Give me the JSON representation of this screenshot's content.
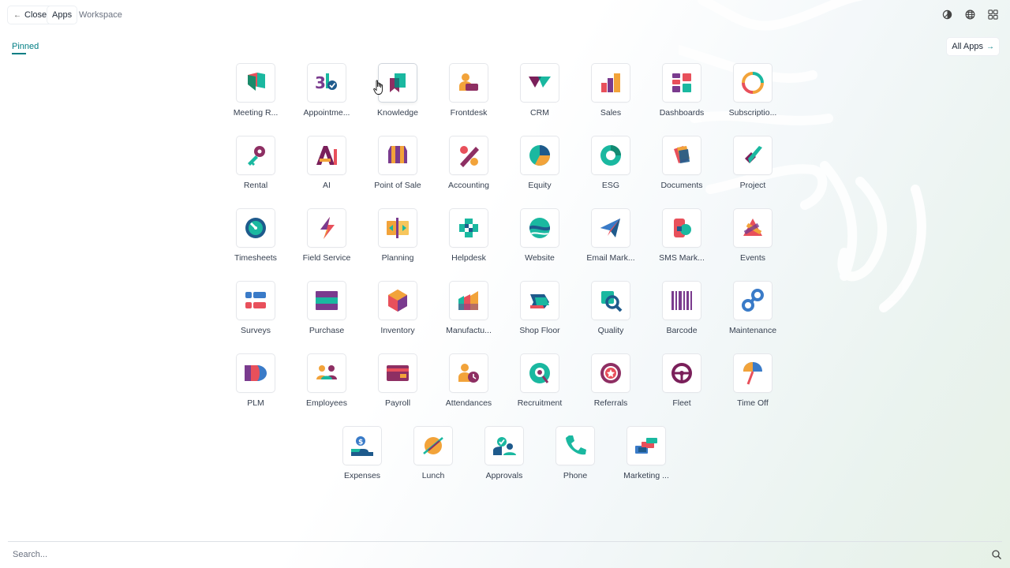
{
  "topbar": {
    "close_label": "Close",
    "close_icon": "arrow-left-icon",
    "tab_apps": "Apps",
    "tab_workspace": "Workspace",
    "icons": [
      "theme-toggle-icon",
      "globe-icon",
      "apps-grid-icon"
    ]
  },
  "section": {
    "pinned": "Pinned",
    "all_apps": "All Apps"
  },
  "apps": [
    {
      "label": "Meeting R...",
      "icon": "meeting-rooms-icon"
    },
    {
      "label": "Appointme...",
      "icon": "appointments-icon"
    },
    {
      "label": "Knowledge",
      "icon": "knowledge-icon"
    },
    {
      "label": "Frontdesk",
      "icon": "frontdesk-icon"
    },
    {
      "label": "CRM",
      "icon": "crm-icon"
    },
    {
      "label": "Sales",
      "icon": "sales-icon"
    },
    {
      "label": "Dashboards",
      "icon": "dashboards-icon"
    },
    {
      "label": "Subscriptio...",
      "icon": "subscriptions-icon"
    },
    {
      "label": "Rental",
      "icon": "rental-icon"
    },
    {
      "label": "AI",
      "icon": "ai-icon"
    },
    {
      "label": "Point of Sale",
      "icon": "point-of-sale-icon"
    },
    {
      "label": "Accounting",
      "icon": "accounting-icon"
    },
    {
      "label": "Equity",
      "icon": "equity-icon"
    },
    {
      "label": "ESG",
      "icon": "esg-icon"
    },
    {
      "label": "Documents",
      "icon": "documents-icon"
    },
    {
      "label": "Project",
      "icon": "project-icon"
    },
    {
      "label": "Timesheets",
      "icon": "timesheets-icon"
    },
    {
      "label": "Field Service",
      "icon": "field-service-icon"
    },
    {
      "label": "Planning",
      "icon": "planning-icon"
    },
    {
      "label": "Helpdesk",
      "icon": "helpdesk-icon"
    },
    {
      "label": "Website",
      "icon": "website-icon"
    },
    {
      "label": "Email Mark...",
      "icon": "email-marketing-icon"
    },
    {
      "label": "SMS Mark...",
      "icon": "sms-marketing-icon"
    },
    {
      "label": "Events",
      "icon": "events-icon"
    },
    {
      "label": "Surveys",
      "icon": "surveys-icon"
    },
    {
      "label": "Purchase",
      "icon": "purchase-icon"
    },
    {
      "label": "Inventory",
      "icon": "inventory-icon"
    },
    {
      "label": "Manufactu...",
      "icon": "manufacturing-icon"
    },
    {
      "label": "Shop Floor",
      "icon": "shop-floor-icon"
    },
    {
      "label": "Quality",
      "icon": "quality-icon"
    },
    {
      "label": "Barcode",
      "icon": "barcode-icon"
    },
    {
      "label": "Maintenance",
      "icon": "maintenance-icon"
    },
    {
      "label": "PLM",
      "icon": "plm-icon"
    },
    {
      "label": "Employees",
      "icon": "employees-icon"
    },
    {
      "label": "Payroll",
      "icon": "payroll-icon"
    },
    {
      "label": "Attendances",
      "icon": "attendances-icon"
    },
    {
      "label": "Recruitment",
      "icon": "recruitment-icon"
    },
    {
      "label": "Referrals",
      "icon": "referrals-icon"
    },
    {
      "label": "Fleet",
      "icon": "fleet-icon"
    },
    {
      "label": "Time Off",
      "icon": "time-off-icon"
    },
    {
      "label": "Expenses",
      "icon": "expenses-icon"
    },
    {
      "label": "Lunch",
      "icon": "lunch-icon"
    },
    {
      "label": "Approvals",
      "icon": "approvals-icon"
    },
    {
      "label": "Phone",
      "icon": "phone-icon"
    },
    {
      "label": "Marketing ...",
      "icon": "marketing-icon"
    }
  ],
  "search": {
    "placeholder": "Search...",
    "icon": "search-icon"
  }
}
